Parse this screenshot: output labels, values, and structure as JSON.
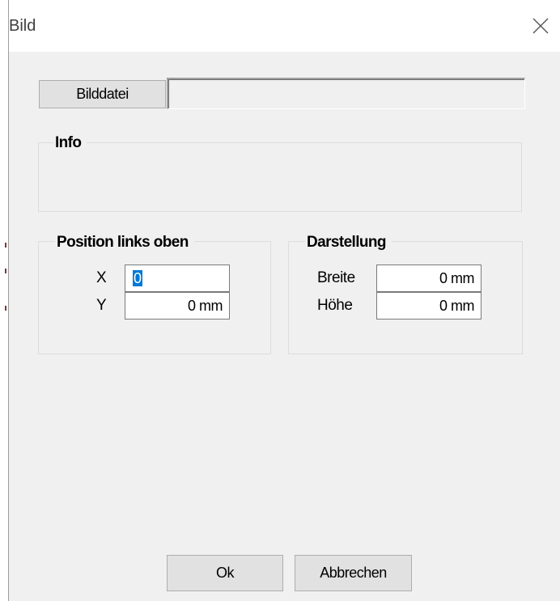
{
  "window": {
    "title": "Bild"
  },
  "file": {
    "button_label": "Bilddatei",
    "path_value": ""
  },
  "info": {
    "title": "Info"
  },
  "position": {
    "title": "Position links oben",
    "x_label": "X",
    "x_value": "0",
    "y_label": "Y",
    "y_value": "0 mm"
  },
  "display": {
    "title": "Darstellung",
    "width_label": "Breite",
    "width_value": "0 mm",
    "height_label": "Höhe",
    "height_value": "0 mm"
  },
  "buttons": {
    "ok": "Ok",
    "cancel": "Abbrechen"
  },
  "icons": {
    "close": "close-icon"
  }
}
